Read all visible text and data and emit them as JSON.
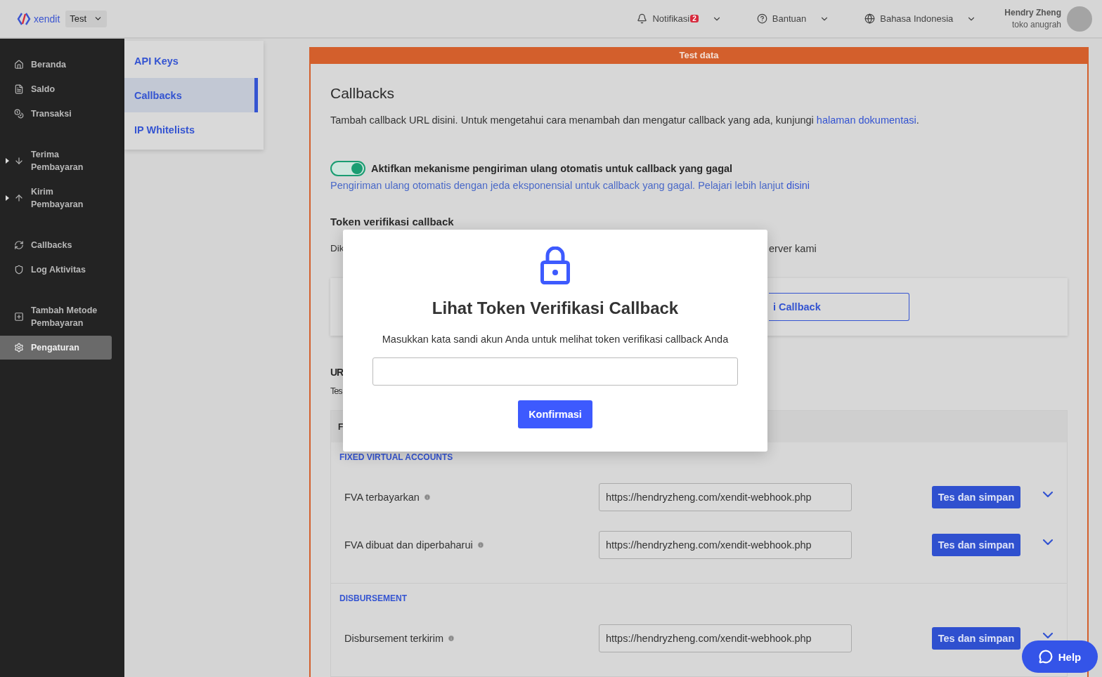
{
  "topbar": {
    "brand": "xendit",
    "environment": "Test",
    "nav": [
      {
        "kind": "bell",
        "label": "Notifikasi",
        "badge": "2"
      },
      {
        "kind": "help",
        "label": "Bantuan"
      },
      {
        "kind": "globe",
        "label": "Bahasa Indonesia"
      }
    ],
    "user": {
      "name": "Hendry Zheng",
      "store": "toko anugrah"
    }
  },
  "sidebar": {
    "groups": [
      [
        {
          "label": "Beranda",
          "expandable": false,
          "selected": false
        },
        {
          "label": "Saldo",
          "expandable": false,
          "selected": false
        },
        {
          "label": "Transaksi",
          "expandable": false,
          "selected": false
        }
      ],
      [
        {
          "label": "Terima Pembayaran",
          "expandable": true,
          "selected": false
        },
        {
          "label": "Kirim Pembayaran",
          "expandable": true,
          "selected": false
        }
      ],
      [
        {
          "label": "Callbacks",
          "expandable": false,
          "selected": false
        },
        {
          "label": "Log Aktivitas",
          "expandable": false,
          "selected": false
        }
      ],
      [
        {
          "label": "Tambah Metode Pembayaran",
          "expandable": false,
          "selected": false
        },
        {
          "label": "Pengaturan",
          "expandable": false,
          "selected": true
        }
      ]
    ]
  },
  "submenu": [
    {
      "label": "API Keys",
      "selected": false
    },
    {
      "label": "Callbacks",
      "selected": true
    },
    {
      "label": "IP Whitelists",
      "selected": false
    }
  ],
  "banner": "Test data",
  "callbacks": {
    "title": "Callbacks",
    "description": "Tambah callback URL disini. Untuk mengetahui cara menambah dan mengatur callback yang ada, kunjungi",
    "description_link": "halaman dokumentasi",
    "description_end": ".",
    "retry": {
      "on": true,
      "label": "Aktifkan mekanisme pengiriman ulang otomatis untuk callback yang gagal",
      "hint": "Pengiriman ulang otomatis dengan jeda eksponensial untuk callback yang gagal. Pelajari lebih lanjut",
      "hint_link": "disini"
    }
  },
  "token": {
    "title": "Token verifikasi callback",
    "description_start": "Dik",
    "description_end": "erver kami",
    "button": "i Callback"
  },
  "urls": {
    "title": "UR",
    "description": "Tes",
    "table_header": "F",
    "groups": [
      {
        "heading": "FIXED VIRTUAL ACCOUNTS",
        "rows": [
          {
            "label": "FVA terbayarkan",
            "value": "https://hendryzheng.com/xendit-webhook.php",
            "button": "Tes dan simpan"
          },
          {
            "label": "FVA dibuat dan diperbaharui",
            "value": "https://hendryzheng.com/xendit-webhook.php",
            "button": "Tes dan simpan"
          }
        ]
      },
      {
        "heading": "DISBURSEMENT",
        "rows": [
          {
            "label": "Disbursement terkirim",
            "value": "https://hendryzheng.com/xendit-webhook.php",
            "button": "Tes dan simpan"
          }
        ]
      }
    ]
  },
  "modal": {
    "title": "Lihat Token Verifikasi Callback",
    "message": "Masukkan kata sandi akun Anda untuk melihat token verifikasi callback Anda",
    "button": "Konfirmasi"
  },
  "help": "Help"
}
